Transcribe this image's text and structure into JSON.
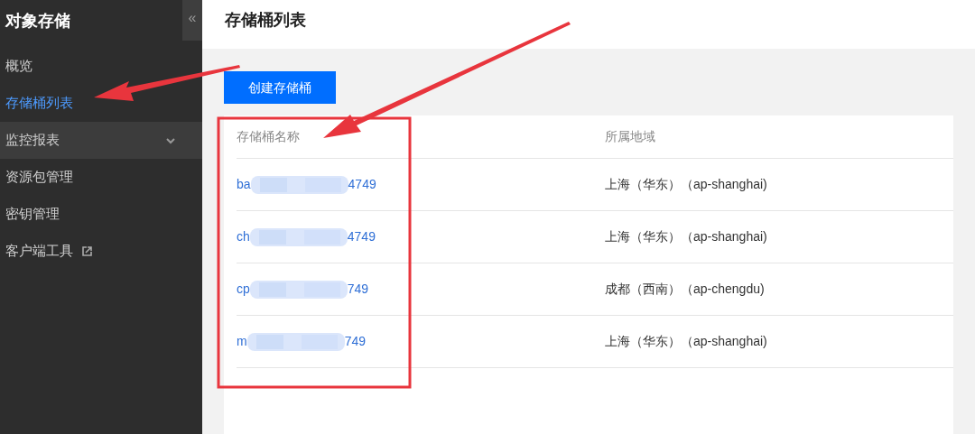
{
  "sidebar": {
    "title": "对象存储",
    "collapse_glyph": "«",
    "items": [
      {
        "label": "概览",
        "kind": "link",
        "selected": false
      },
      {
        "label": "存储桶列表",
        "kind": "link",
        "selected": true
      },
      {
        "label": "监控报表",
        "kind": "group",
        "selected": false,
        "expanded": false
      },
      {
        "label": "资源包管理",
        "kind": "link",
        "selected": false
      },
      {
        "label": "密钥管理",
        "kind": "link",
        "selected": false
      },
      {
        "label": "客户端工具",
        "kind": "external",
        "selected": false
      }
    ]
  },
  "page": {
    "title": "存储桶列表",
    "create_button": "创建存储桶"
  },
  "table": {
    "columns": [
      "存储桶名称",
      "所属地域"
    ],
    "rows": [
      {
        "name_start": "ba",
        "name_end": "4749",
        "region": "上海（华东）（ap-shanghai)"
      },
      {
        "name_start": "ch",
        "name_end": "4749",
        "region": "上海（华东）（ap-shanghai)"
      },
      {
        "name_start": "cp",
        "name_end": "749",
        "region": "成都（西南）（ap-chengdu)"
      },
      {
        "name_start": "m",
        "name_end": "749",
        "region": "上海（华东）（ap-shanghai)"
      }
    ]
  }
}
